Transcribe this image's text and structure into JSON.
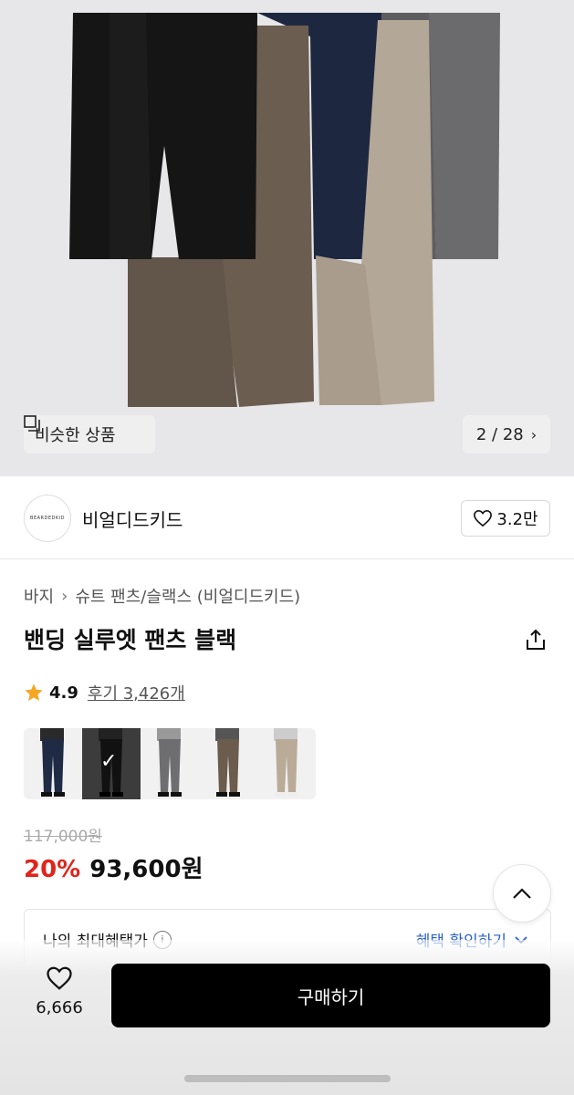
{
  "gallery": {
    "similar_label": "비슷한 상품",
    "counter": "2 / 28",
    "similar_icon": "similar-items-icon",
    "next_icon": "chevron-right-icon"
  },
  "brand": {
    "logo_text": "BEARDEDKID",
    "name": "비얼디드키드",
    "like_count": "3.2만"
  },
  "breadcrumb": {
    "category": "바지",
    "subcategory": "슈트 팬츠/슬랙스 (비얼디드키드)"
  },
  "product": {
    "title": "밴딩 실루엣 팬츠 블랙",
    "rating": "4.9",
    "reviews": "후기 3,426개",
    "original_price": "117,000원",
    "discount": "20%",
    "price": "93,600원"
  },
  "color_options": [
    {
      "name": "navy",
      "color": "#1f2a44",
      "selected": false
    },
    {
      "name": "black",
      "color": "#111111",
      "selected": true
    },
    {
      "name": "gray",
      "color": "#6e6e70",
      "selected": false
    },
    {
      "name": "brown",
      "color": "#6b5c4d",
      "selected": false
    },
    {
      "name": "beige",
      "color": "#b9ab98",
      "selected": false
    }
  ],
  "benefit": {
    "label": "나의 최대혜택가",
    "link": "혜택 확인하기"
  },
  "bottom_bar": {
    "wish_count": "6,666",
    "buy_label": "구매하기"
  },
  "colors": {
    "accent_red": "#e0241b",
    "link_blue": "#2a5fce",
    "star": "#f5a623"
  }
}
